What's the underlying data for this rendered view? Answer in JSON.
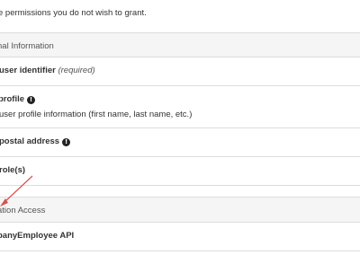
{
  "intro_text": "e permissions you do not wish to grant.",
  "groups": [
    {
      "header": "nal Information",
      "items": [
        {
          "title": "user identifier",
          "required": "(required)",
          "description": "",
          "info_icon": "info-circle-icon"
        },
        {
          "title": "profile",
          "required": "",
          "description": "user profile information (first name, last name, etc.)",
          "info_icon": "info-circle-icon"
        },
        {
          "title": "postal address",
          "required": "",
          "description": "",
          "info_icon": "info-circle-icon"
        },
        {
          "title": "role(s)",
          "required": "",
          "description": "",
          "info_icon": ""
        }
      ]
    },
    {
      "header": "ation Access",
      "items": [
        {
          "title": "panyEmployee API",
          "required": "",
          "description": "",
          "info_icon": ""
        }
      ]
    }
  ],
  "arrow_color": "#d9534f"
}
